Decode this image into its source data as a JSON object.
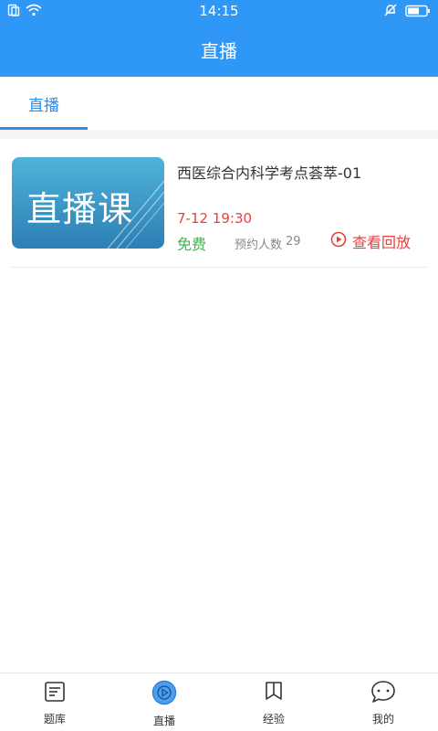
{
  "status_bar": {
    "time": "14:15"
  },
  "header": {
    "title": "直播"
  },
  "tabs": [
    {
      "label": "直播",
      "active": true
    }
  ],
  "course": {
    "thumbnail_text": "直播课",
    "title": "西医综合内科学考点荟萃-01",
    "time": "7-12 19:30",
    "price": "免费",
    "reserve_label": "预约人数",
    "reserve_count": "29",
    "replay_label": "查看回放"
  },
  "bottom_nav": {
    "items": [
      {
        "label": "题库",
        "icon": "question-bank-icon"
      },
      {
        "label": "直播",
        "icon": "play-icon",
        "active": true
      },
      {
        "label": "经验",
        "icon": "bookmark-icon"
      },
      {
        "label": "我的",
        "icon": "chat-bubble-icon"
      }
    ]
  },
  "colors": {
    "primary": "#2f97f5",
    "tab_active": "#2f8ee8",
    "accent_red": "#e84141",
    "free_green": "#3bb54a"
  }
}
